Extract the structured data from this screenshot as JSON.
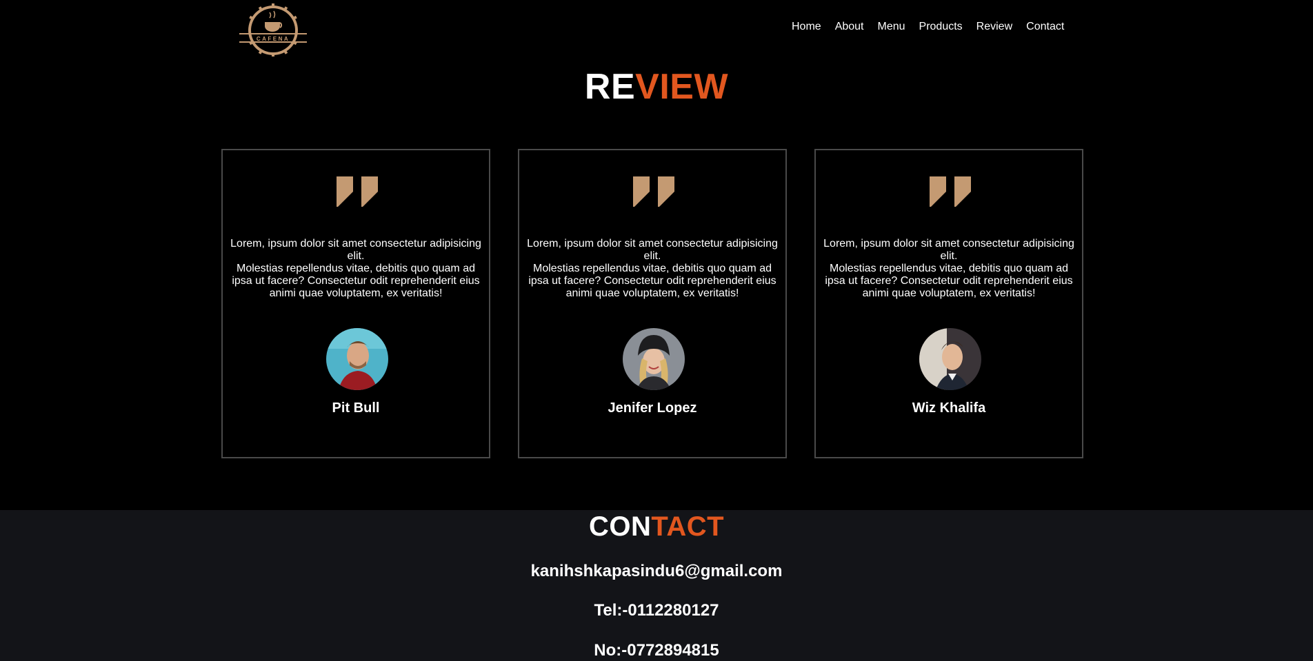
{
  "nav": {
    "logo_text": "CAFENA",
    "items": [
      {
        "label": "Home"
      },
      {
        "label": "About"
      },
      {
        "label": "Menu"
      },
      {
        "label": "Products"
      },
      {
        "label": "Review"
      },
      {
        "label": "Contact"
      }
    ]
  },
  "review": {
    "title_part1": "RE",
    "title_part2": "VIEW",
    "cards": [
      {
        "text": "Lorem, ipsum dolor sit amet consectetur adipisicing elit.\nMolestias repellendus vitae, debitis quo quam ad ipsa ut facere? Consectetur odit reprehenderit eius animi quae voluptatem, ex veritatis!",
        "name": "Pit Bull"
      },
      {
        "text": "Lorem, ipsum dolor sit amet consectetur adipisicing elit.\nMolestias repellendus vitae, debitis quo quam ad ipsa ut facere? Consectetur odit reprehenderit eius animi quae voluptatem, ex veritatis!",
        "name": "Jenifer Lopez"
      },
      {
        "text": "Lorem, ipsum dolor sit amet consectetur adipisicing elit.\nMolestias repellendus vitae, debitis quo quam ad ipsa ut facere? Consectetur odit reprehenderit eius animi quae voluptatem, ex veritatis!",
        "name": "Wiz Khalifa"
      }
    ]
  },
  "contact": {
    "title_part1": "CON",
    "title_part2": "TACT",
    "email": "kanihshkapasindu6@gmail.com",
    "tel": "Tel:-0112280127",
    "no": "No:-0772894815"
  },
  "colors": {
    "accent": "#e2571f",
    "quote": "#c49a72",
    "card_border": "#4a4a4a",
    "contact_bg": "#131418"
  }
}
